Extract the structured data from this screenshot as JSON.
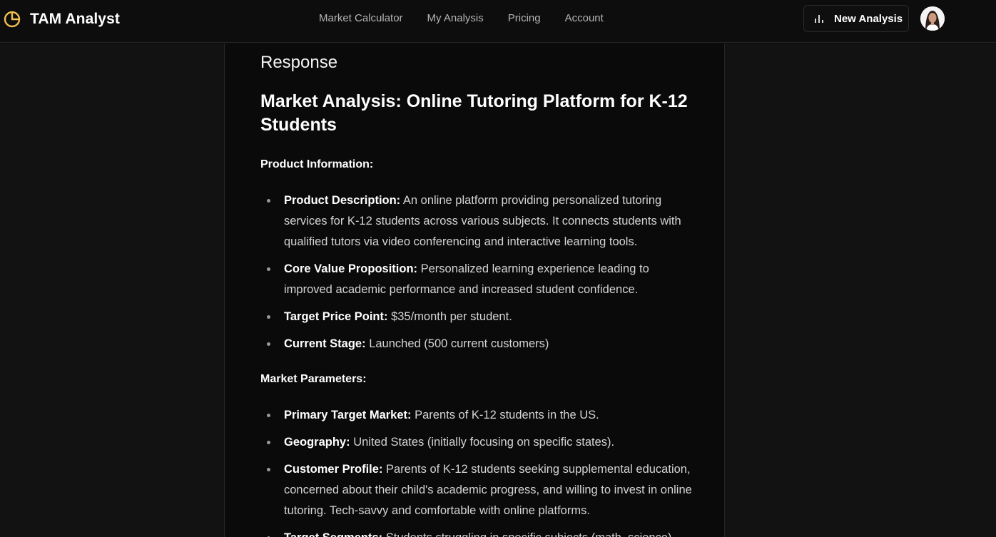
{
  "app": {
    "name": "TAM Analyst",
    "logo_icon": "pie-chart-icon",
    "accent_color": "#f2c14e"
  },
  "nav": {
    "items": [
      {
        "label": "Market Calculator"
      },
      {
        "label": "My Analysis"
      },
      {
        "label": "Pricing"
      },
      {
        "label": "Account"
      }
    ]
  },
  "header": {
    "new_analysis_label": "New Analysis",
    "new_analysis_icon": "bar-chart-icon",
    "avatar_icon": "user-avatar"
  },
  "response": {
    "label": "Response",
    "title": "Market Analysis: Online Tutoring Platform for K-12 Students",
    "sections": [
      {
        "heading": "Product Information:",
        "items": [
          {
            "key": "Product Description:",
            "value": "An online platform providing personalized tutoring services for K-12 students across various subjects. It connects students with qualified tutors via video conferencing and interactive learning tools."
          },
          {
            "key": "Core Value Proposition:",
            "value": "Personalized learning experience leading to improved academic performance and increased student confidence."
          },
          {
            "key": "Target Price Point:",
            "value": "$35/month per student."
          },
          {
            "key": "Current Stage:",
            "value": "Launched (500 current customers)"
          }
        ]
      },
      {
        "heading": "Market Parameters:",
        "items": [
          {
            "key": "Primary Target Market:",
            "value": "Parents of K-12 students in the US."
          },
          {
            "key": "Geography:",
            "value": "United States (initially focusing on specific states)."
          },
          {
            "key": "Customer Profile:",
            "value": "Parents of K-12 students seeking supplemental education, concerned about their child's academic progress, and willing to invest in online tutoring. Tech-savvy and comfortable with online platforms."
          },
          {
            "key": "Target Segments:",
            "value": "Students struggling in specific subjects (math, science)"
          }
        ]
      }
    ]
  }
}
